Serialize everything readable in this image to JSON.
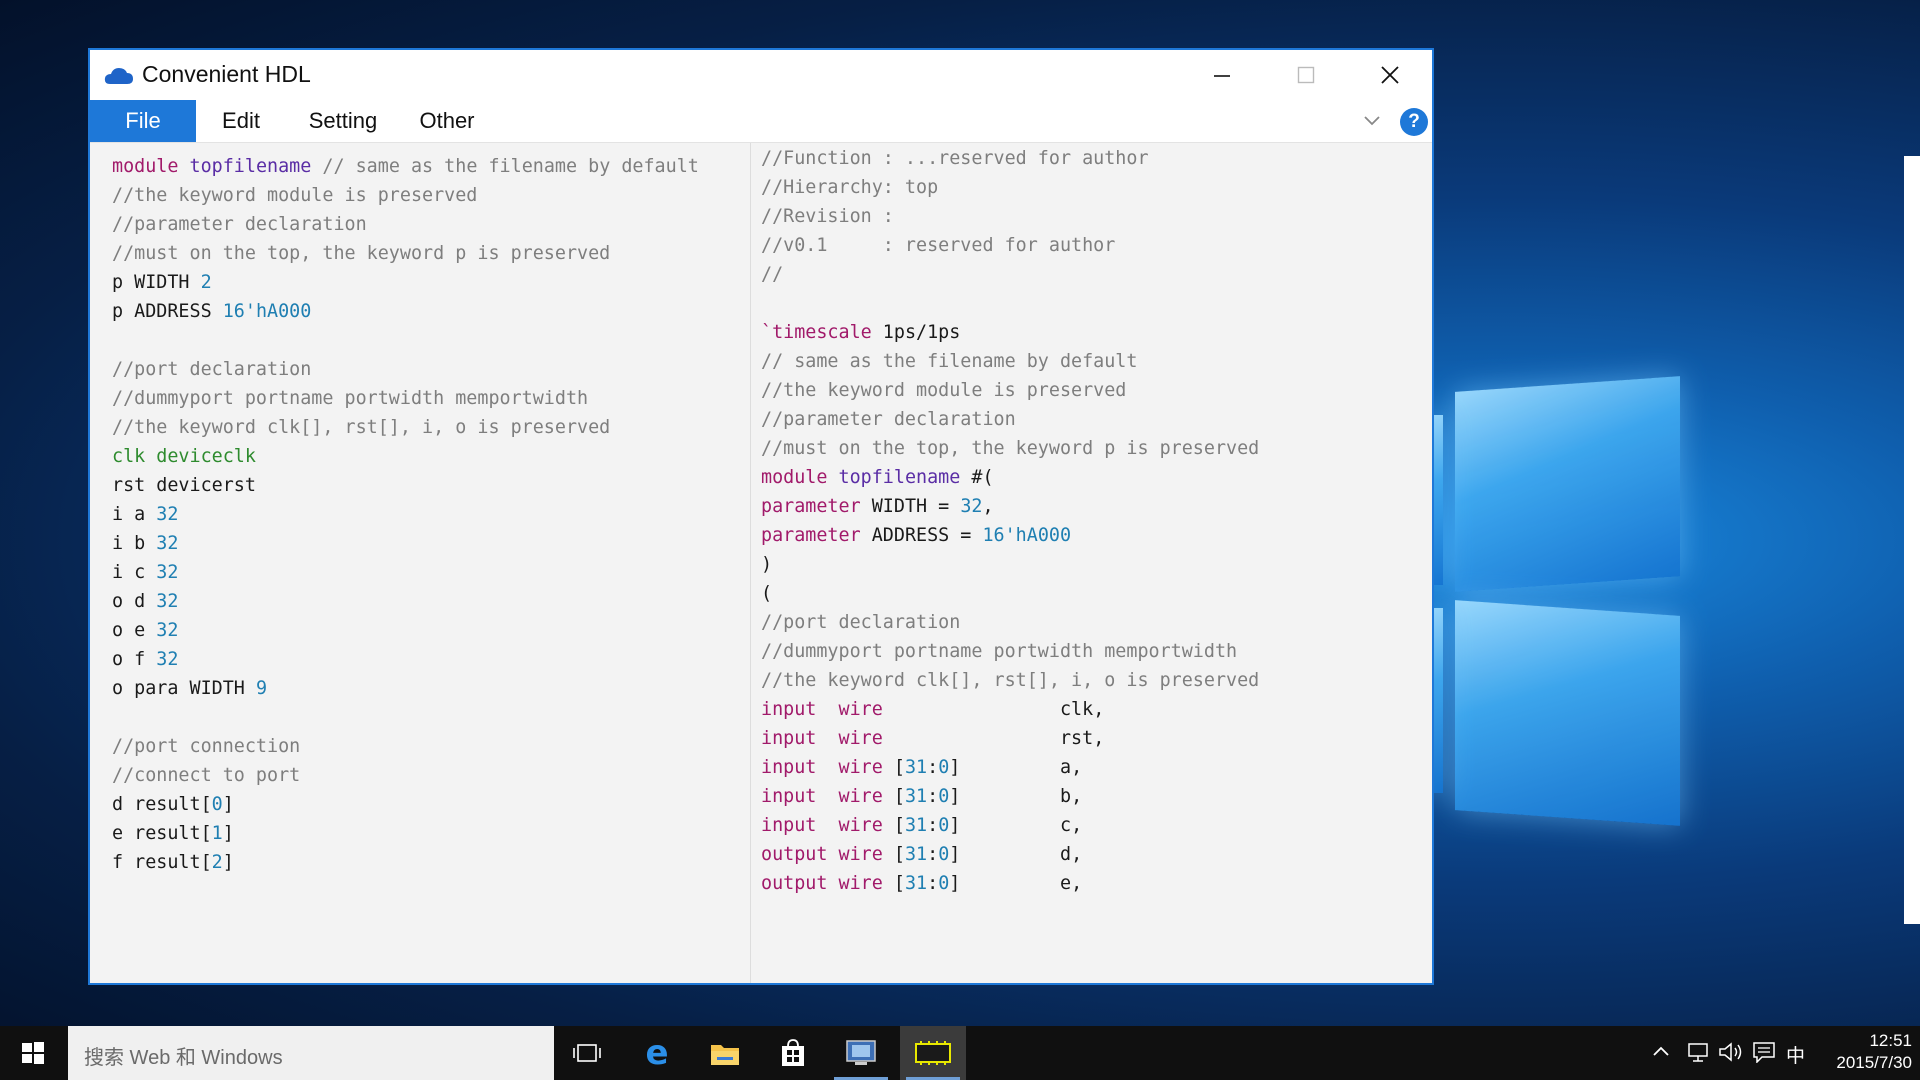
{
  "window": {
    "title": "Convenient HDL",
    "accent": "#1e78d8"
  },
  "menu": {
    "items": [
      "File",
      "Edit",
      "Setting",
      "Other"
    ],
    "active": "File",
    "help_label": "?"
  },
  "left_code": [
    [
      [
        "kw",
        "module"
      ],
      [
        "t",
        " "
      ],
      [
        "id",
        "topfilename"
      ],
      [
        "t",
        " "
      ],
      [
        "cm",
        "// same as the filename by default"
      ]
    ],
    [
      [
        "cm",
        "//the keyword module is preserved"
      ]
    ],
    [
      [
        "cm",
        "//parameter declaration"
      ]
    ],
    [
      [
        "cm",
        "//must on the top, the keyword p is preserved"
      ]
    ],
    [
      [
        "t",
        "p WIDTH "
      ],
      [
        "num",
        "2"
      ]
    ],
    [
      [
        "t",
        "p ADDRESS "
      ],
      [
        "num",
        "16'hA000"
      ]
    ],
    [],
    [
      [
        "cm",
        "//port declaration"
      ]
    ],
    [
      [
        "cm",
        "//dummyport portname portwidth memportwidth"
      ]
    ],
    [
      [
        "cm",
        "//the keyword clk[], rst[], i, o is preserved"
      ]
    ],
    [
      [
        "gr",
        "clk deviceclk"
      ]
    ],
    [
      [
        "t",
        "rst devicerst"
      ]
    ],
    [
      [
        "t",
        "i a "
      ],
      [
        "num",
        "32"
      ]
    ],
    [
      [
        "t",
        "i b "
      ],
      [
        "num",
        "32"
      ]
    ],
    [
      [
        "t",
        "i c "
      ],
      [
        "num",
        "32"
      ]
    ],
    [
      [
        "t",
        "o d "
      ],
      [
        "num",
        "32"
      ]
    ],
    [
      [
        "t",
        "o e "
      ],
      [
        "num",
        "32"
      ]
    ],
    [
      [
        "t",
        "o f "
      ],
      [
        "num",
        "32"
      ]
    ],
    [
      [
        "t",
        "o para WIDTH "
      ],
      [
        "num",
        "9"
      ]
    ],
    [],
    [
      [
        "cm",
        "//port connection"
      ]
    ],
    [
      [
        "cm",
        "//connect to port"
      ]
    ],
    [
      [
        "t",
        "d result["
      ],
      [
        "num",
        "0"
      ],
      [
        "t",
        "]"
      ]
    ],
    [
      [
        "t",
        "e result["
      ],
      [
        "num",
        "1"
      ],
      [
        "t",
        "]"
      ]
    ],
    [
      [
        "t",
        "f result["
      ],
      [
        "num",
        "2"
      ],
      [
        "t",
        "]"
      ]
    ]
  ],
  "right_code": [
    [
      [
        "cm",
        "//Function : ...reserved for author"
      ]
    ],
    [
      [
        "cm",
        "//Hierarchy: top"
      ]
    ],
    [
      [
        "cm",
        "//Revision :"
      ]
    ],
    [
      [
        "cm",
        "//v0.1     : reserved for author"
      ]
    ],
    [
      [
        "cm",
        "//"
      ]
    ],
    [],
    [
      [
        "kw",
        "`timescale"
      ],
      [
        "t",
        " 1ps/1ps"
      ]
    ],
    [
      [
        "cm",
        "// same as the filename by default"
      ]
    ],
    [
      [
        "cm",
        "//the keyword module is preserved"
      ]
    ],
    [
      [
        "cm",
        "//parameter declaration"
      ]
    ],
    [
      [
        "cm",
        "//must on the top, the keyword p is preserved"
      ]
    ],
    [
      [
        "kw",
        "module"
      ],
      [
        "t",
        " "
      ],
      [
        "id",
        "topfilename"
      ],
      [
        "t",
        " #("
      ]
    ],
    [
      [
        "kw",
        "parameter"
      ],
      [
        "t",
        " WIDTH = "
      ],
      [
        "num",
        "32"
      ],
      [
        "t",
        ","
      ]
    ],
    [
      [
        "kw",
        "parameter"
      ],
      [
        "t",
        " ADDRESS = "
      ],
      [
        "num",
        "16'hA000"
      ]
    ],
    [
      [
        "t",
        ")"
      ]
    ],
    [
      [
        "t",
        "("
      ]
    ],
    [
      [
        "cm",
        "//port declaration"
      ]
    ],
    [
      [
        "cm",
        "//dummyport portname portwidth memportwidth"
      ]
    ],
    [
      [
        "cm",
        "//the keyword clk[], rst[], i, o is preserved"
      ]
    ],
    [
      [
        "kw",
        "input"
      ],
      [
        "t",
        "  "
      ],
      [
        "kw",
        "wire"
      ],
      [
        "t",
        "                clk,"
      ]
    ],
    [
      [
        "kw",
        "input"
      ],
      [
        "t",
        "  "
      ],
      [
        "kw",
        "wire"
      ],
      [
        "t",
        "                rst,"
      ]
    ],
    [
      [
        "kw",
        "input"
      ],
      [
        "t",
        "  "
      ],
      [
        "kw",
        "wire"
      ],
      [
        "t",
        " ["
      ],
      [
        "num",
        "31"
      ],
      [
        "t",
        ":"
      ],
      [
        "num",
        "0"
      ],
      [
        "t",
        "]         a,"
      ]
    ],
    [
      [
        "kw",
        "input"
      ],
      [
        "t",
        "  "
      ],
      [
        "kw",
        "wire"
      ],
      [
        "t",
        " ["
      ],
      [
        "num",
        "31"
      ],
      [
        "t",
        ":"
      ],
      [
        "num",
        "0"
      ],
      [
        "t",
        "]         b,"
      ]
    ],
    [
      [
        "kw",
        "input"
      ],
      [
        "t",
        "  "
      ],
      [
        "kw",
        "wire"
      ],
      [
        "t",
        " ["
      ],
      [
        "num",
        "31"
      ],
      [
        "t",
        ":"
      ],
      [
        "num",
        "0"
      ],
      [
        "t",
        "]         c,"
      ]
    ],
    [
      [
        "kw",
        "output"
      ],
      [
        "t",
        " "
      ],
      [
        "kw",
        "wire"
      ],
      [
        "t",
        " ["
      ],
      [
        "num",
        "31"
      ],
      [
        "t",
        ":"
      ],
      [
        "num",
        "0"
      ],
      [
        "t",
        "]         d,"
      ]
    ],
    [
      [
        "kw",
        "output"
      ],
      [
        "t",
        " "
      ],
      [
        "kw",
        "wire"
      ],
      [
        "t",
        " ["
      ],
      [
        "num",
        "31"
      ],
      [
        "t",
        ":"
      ],
      [
        "num",
        "0"
      ],
      [
        "t",
        "]         e,"
      ]
    ]
  ],
  "taskbar": {
    "search_placeholder": "搜索 Web 和 Windows",
    "ime": "中",
    "time": "12:51",
    "date": "2015/7/30"
  }
}
